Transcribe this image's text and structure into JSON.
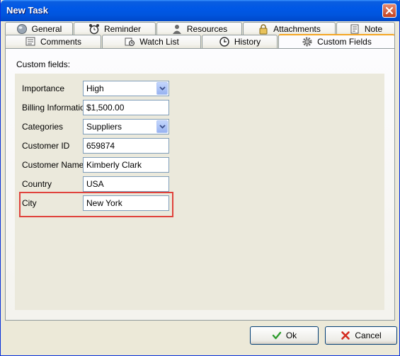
{
  "window": {
    "title": "New Task"
  },
  "tabs_row1": [
    {
      "label": "General",
      "icon": "globe-icon"
    },
    {
      "label": "Reminder",
      "icon": "alarm-clock-icon"
    },
    {
      "label": "Resources",
      "icon": "user-icon"
    },
    {
      "label": "Attachments",
      "icon": "lock-icon"
    },
    {
      "label": "Note",
      "icon": "note-icon"
    }
  ],
  "tabs_row2": [
    {
      "label": "Comments",
      "icon": "comments-icon"
    },
    {
      "label": "Watch List",
      "icon": "watch-list-icon"
    },
    {
      "label": "History",
      "icon": "history-icon"
    },
    {
      "label": "Custom Fields",
      "icon": "gear-icon",
      "active": true
    }
  ],
  "panel": {
    "label": "Custom fields:"
  },
  "fields": [
    {
      "label": "Importance",
      "value": "High",
      "type": "combo"
    },
    {
      "label": "Billing Information",
      "value": "$1,500.00",
      "type": "text"
    },
    {
      "label": "Categories",
      "value": "Suppliers",
      "type": "combo"
    },
    {
      "label": "Customer ID",
      "value": "659874",
      "type": "text"
    },
    {
      "label": "Customer Name",
      "value": "Kimberly Clark",
      "type": "text"
    },
    {
      "label": "Country",
      "value": "USA",
      "type": "text"
    },
    {
      "label": "City",
      "value": "New York",
      "type": "text"
    }
  ],
  "buttons": {
    "ok": "Ok",
    "cancel": "Cancel"
  },
  "colors": {
    "title_bar": "#0058e6",
    "highlight": "#e0423c",
    "active_tab": "#f5a623"
  }
}
